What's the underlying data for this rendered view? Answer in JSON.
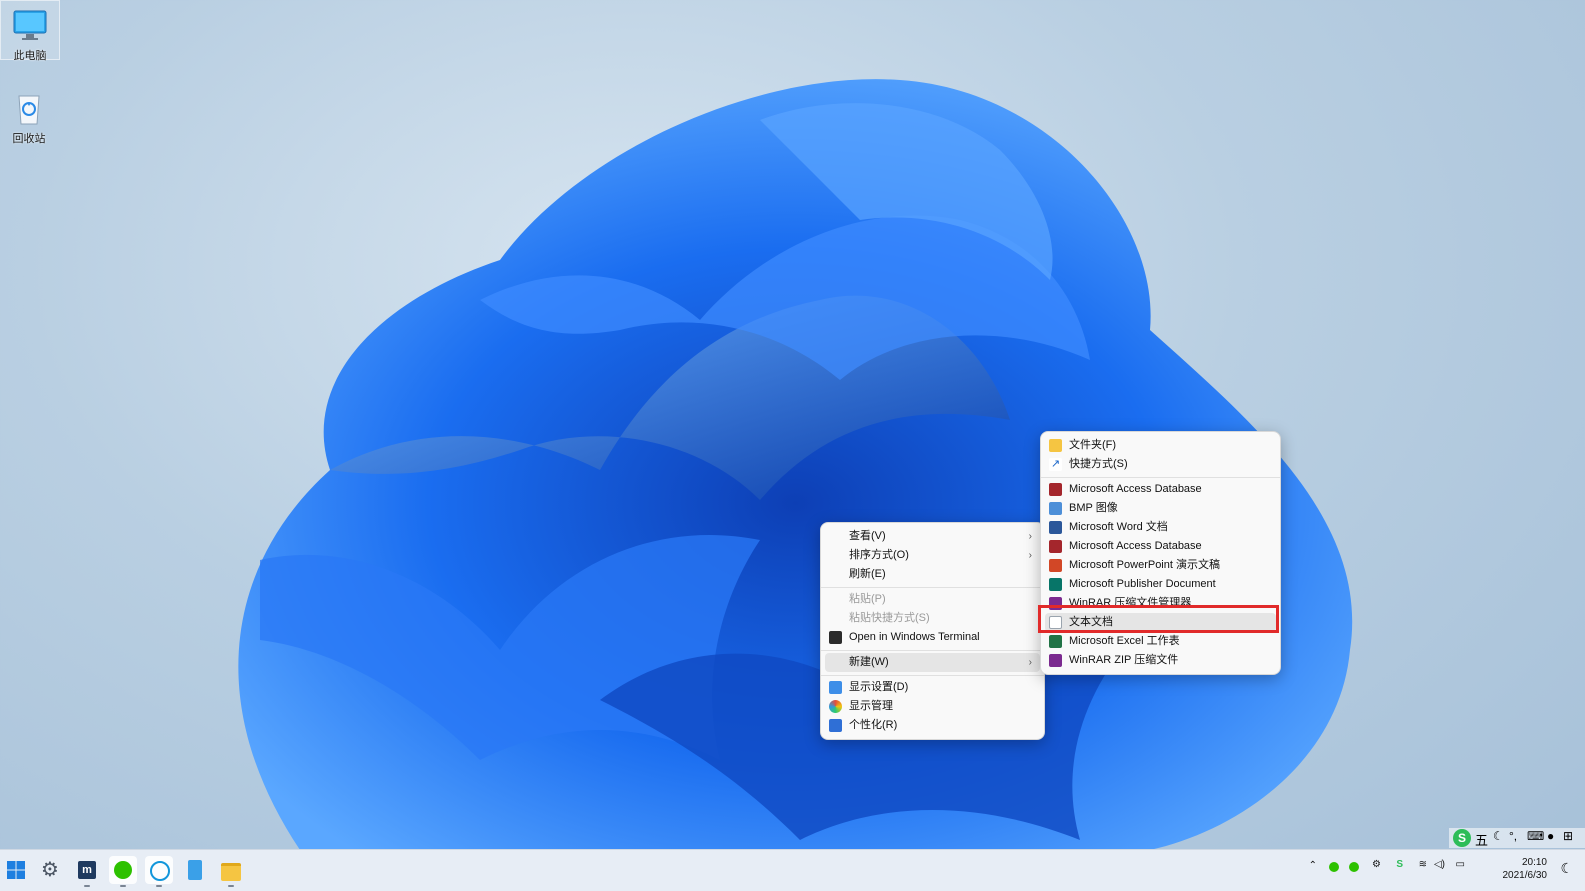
{
  "desktop": {
    "icons": [
      {
        "label": "此电脑"
      },
      {
        "label": "回收站"
      }
    ]
  },
  "context_menu": {
    "items": [
      {
        "label": "查看(V)",
        "submenu": true
      },
      {
        "label": "排序方式(O)",
        "submenu": true
      },
      {
        "label": "刷新(E)"
      },
      {
        "label": "粘贴(P)",
        "disabled": true
      },
      {
        "label": "粘贴快捷方式(S)",
        "disabled": true
      },
      {
        "label": "Open in Windows Terminal"
      },
      {
        "label": "新建(W)",
        "submenu": true,
        "highlighted": true
      },
      {
        "label": "显示设置(D)"
      },
      {
        "label": "显示管理"
      },
      {
        "label": "个性化(R)"
      }
    ]
  },
  "new_submenu": {
    "items": [
      {
        "label": "文件夹(F)"
      },
      {
        "label": "快捷方式(S)"
      },
      {
        "label": "Microsoft Access Database"
      },
      {
        "label": "BMP 图像"
      },
      {
        "label": "Microsoft Word 文档"
      },
      {
        "label": "Microsoft Access Database"
      },
      {
        "label": "Microsoft PowerPoint 演示文稿"
      },
      {
        "label": "Microsoft Publisher Document"
      },
      {
        "label": "WinRAR 压缩文件管理器"
      },
      {
        "label": "文本文档",
        "highlighted": true
      },
      {
        "label": "Microsoft Excel 工作表"
      },
      {
        "label": "WinRAR ZIP 压缩文件"
      }
    ]
  },
  "taskbar": {
    "ime_label": "五",
    "clock_time": "20:10",
    "clock_date": "2021/6/30"
  },
  "colors": {
    "accent": "#0a5cd8",
    "highlight_box": "#e12a2a"
  }
}
